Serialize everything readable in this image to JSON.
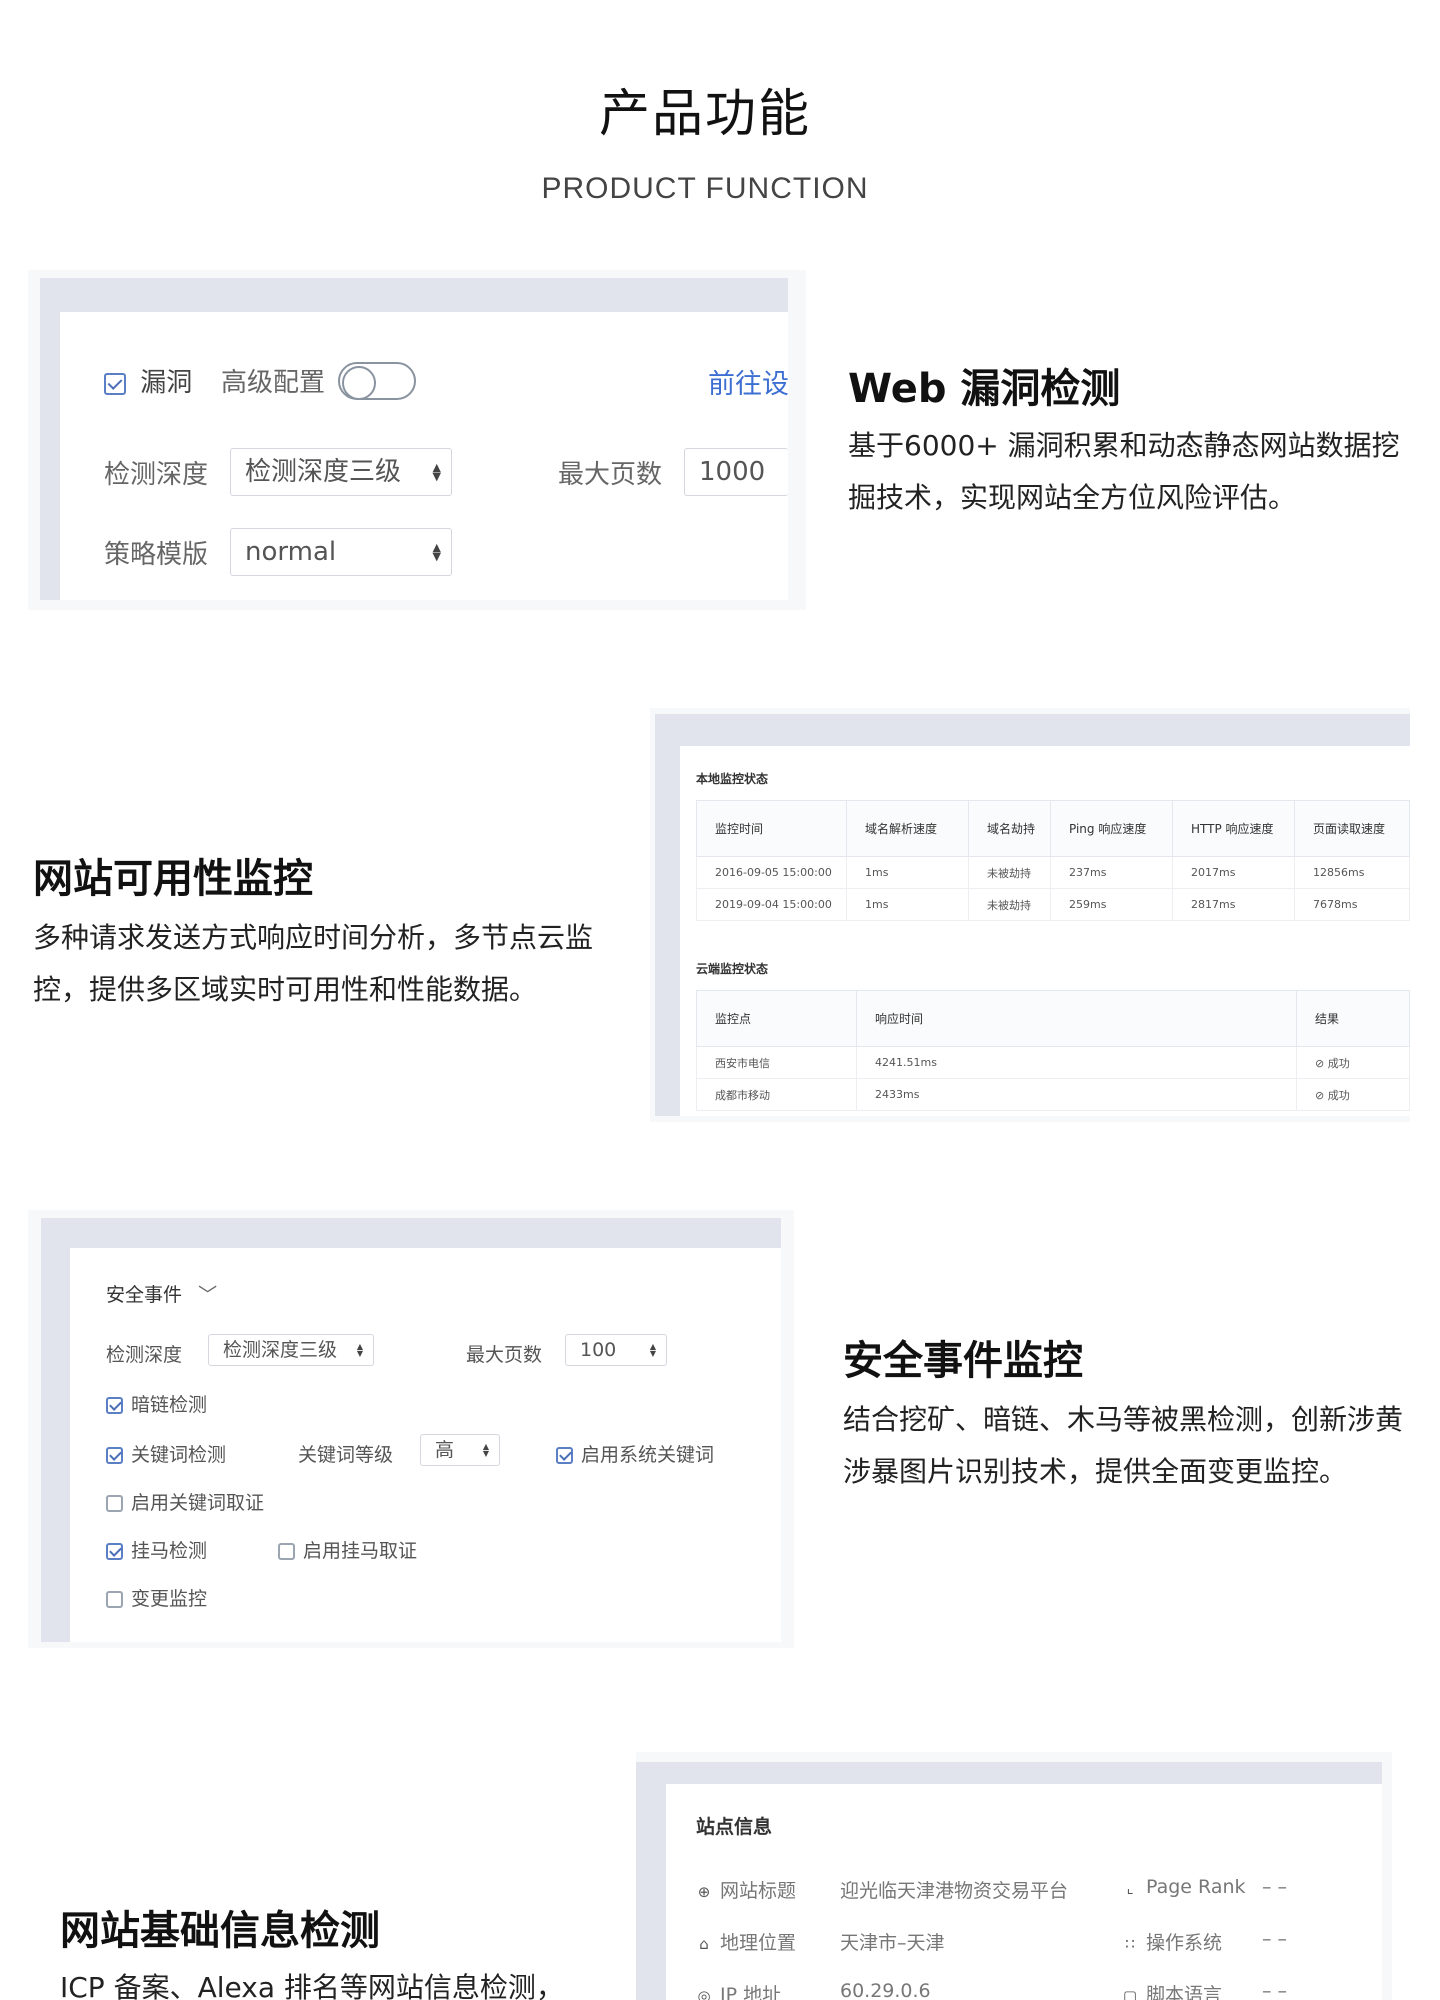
{
  "header": {
    "title": "产品功能",
    "subtitle": "PRODUCT FUNCTION"
  },
  "features": [
    {
      "title": "Web 漏洞检测",
      "desc": "基于6000+ 漏洞积累和动态静态网站数据挖掘技术，实现网站全方位风险评估。"
    },
    {
      "title": "网站可用性监控",
      "desc": "多种请求发送方式响应时间分析，多节点云监控，提供多区域实时可用性和性能数据。"
    },
    {
      "title": "安全事件监控",
      "desc": "结合挖矿、暗链、木马等被黑检测，创新涉黄涉暴图片识别技术，提供全面变更监控。"
    },
    {
      "title": "网站基础信息检测",
      "desc": "ICP 备案、Alexa 排名等网站信息检测，"
    }
  ],
  "card1": {
    "vuln_label": "漏洞",
    "advanced_label": "高级配置",
    "goto_link": "前往设",
    "depth_label": "检测深度",
    "depth_value": "检测深度三级",
    "maxpage_label": "最大页数",
    "maxpage_value": "1000",
    "policy_label": "策略模版",
    "policy_value": "normal"
  },
  "card2": {
    "local_title": "本地监控状态",
    "local_headers": [
      "监控时间",
      "域名解析速度",
      "域名劫持",
      "Ping 响应速度",
      "HTTP 响应速度",
      "页面读取速度"
    ],
    "local_rows": [
      [
        "2016-09-05  15:00:00",
        "1ms",
        "未被劫持",
        "237ms",
        "2017ms",
        "12856ms"
      ],
      [
        "2019-09-04  15:00:00",
        "1ms",
        "未被劫持",
        "259ms",
        "2817ms",
        "7678ms"
      ]
    ],
    "cloud_title": "云端监控状态",
    "cloud_headers": [
      "监控点",
      "响应时间",
      "结果"
    ],
    "cloud_rows": [
      [
        "西安市电信",
        "4241.51ms",
        "成功"
      ],
      [
        "成都市移动",
        "2433ms",
        "成功"
      ]
    ]
  },
  "card3": {
    "event_label": "安全事件",
    "depth_label": "检测深度",
    "depth_value": "检测深度三级",
    "maxpage_label": "最大页数",
    "maxpage_value": "100",
    "darklink": "暗链检测",
    "keyword": "关键词检测",
    "keyword_level_label": "关键词等级",
    "keyword_level_value": "高",
    "sys_keyword": "启用系统关键词",
    "keyword_evidence": "启用关键词取证",
    "trojan": "挂马检测",
    "trojan_evidence": "启用挂马取证",
    "change": "变更监控"
  },
  "card4": {
    "title": "站点信息",
    "site_title_label": "网站标题",
    "site_title_value": "迎光临天津港物资交易平台",
    "pagerank_label": "Page Rank",
    "pagerank_value": "– –",
    "location_label": "地理位置",
    "location_value": "天津市–天津",
    "os_label": "操作系统",
    "os_value": "– –",
    "ip_label": "IP 地址",
    "ip_value": "60.29.0.6",
    "script_label": "脚本语言",
    "script_value": "– –"
  }
}
